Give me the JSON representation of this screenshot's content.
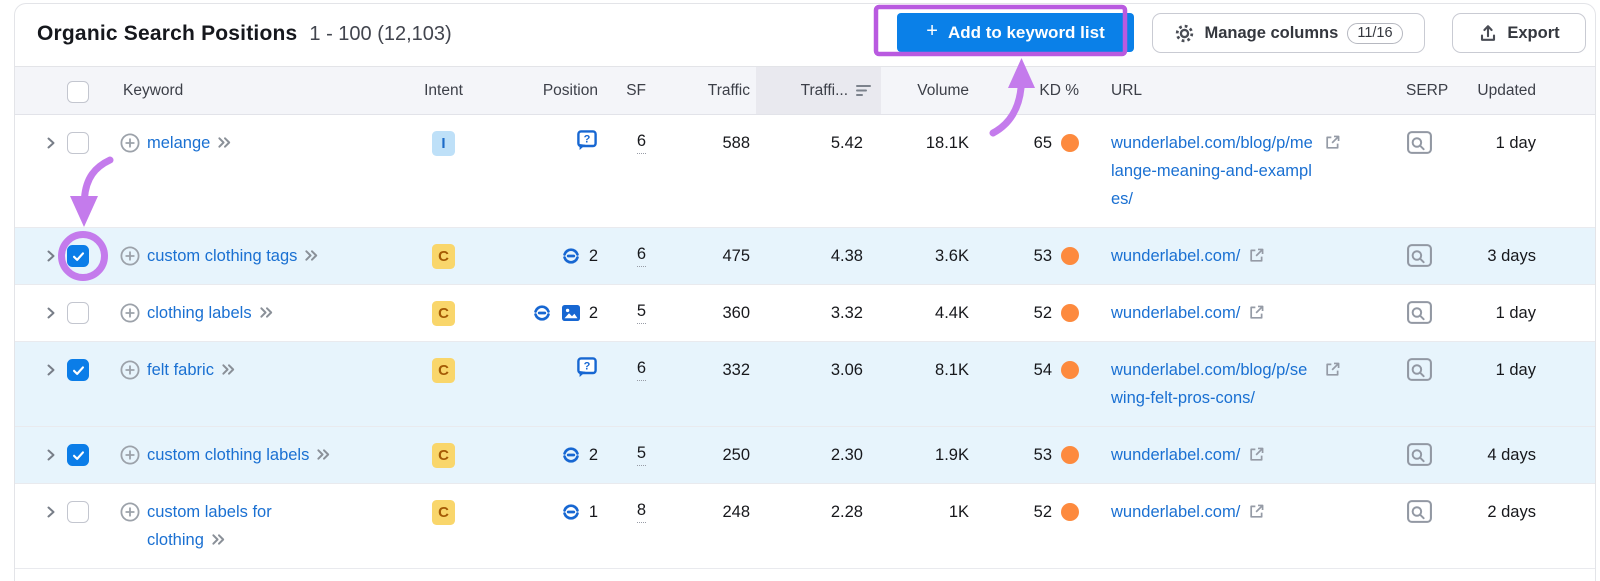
{
  "card": {
    "title": "Organic Search Positions",
    "range": "1 - 100 (12,103)",
    "toolbar": {
      "add_plus": "+",
      "add_label": "Add to keyword list",
      "manage_label": "Manage columns",
      "manage_badge": "11/16",
      "export_label": "Export"
    }
  },
  "table": {
    "headers": {
      "keyword": "Keyword",
      "intent": "Intent",
      "position": "Position",
      "sf": "SF",
      "traffic": "Traffic",
      "traffic_pct": "Traffi...",
      "volume": "Volume",
      "kd": "KD %",
      "url": "URL",
      "serp": "SERP",
      "updated": "Updated"
    },
    "rows": [
      {
        "checked": false,
        "selected": false,
        "keyword": "melange",
        "intent": "I",
        "pos_icons": [
          "question"
        ],
        "position": "",
        "sf": "6",
        "traffic": "588",
        "traffic_pct": "5.42",
        "volume": "18.1K",
        "kd": "65",
        "url": "wunderlabel.com/blog/p/melange-meaning-and-examples/",
        "updated": "1 day"
      },
      {
        "checked": true,
        "selected": true,
        "keyword": "custom clothing tags",
        "intent": "C",
        "pos_icons": [
          "link"
        ],
        "position": "2",
        "sf": "6",
        "traffic": "475",
        "traffic_pct": "4.38",
        "volume": "3.6K",
        "kd": "53",
        "url": "wunderlabel.com/",
        "updated": "3 days"
      },
      {
        "checked": false,
        "selected": false,
        "keyword": "clothing labels",
        "intent": "C",
        "pos_icons": [
          "link",
          "image"
        ],
        "position": "2",
        "sf": "5",
        "traffic": "360",
        "traffic_pct": "3.32",
        "volume": "4.4K",
        "kd": "52",
        "url": "wunderlabel.com/",
        "updated": "1 day"
      },
      {
        "checked": true,
        "selected": true,
        "keyword": "felt fabric",
        "intent": "C",
        "pos_icons": [
          "question"
        ],
        "position": "",
        "sf": "6",
        "traffic": "332",
        "traffic_pct": "3.06",
        "volume": "8.1K",
        "kd": "54",
        "url": "wunderlabel.com/blog/p/sewing-felt-pros-cons/",
        "updated": "1 day"
      },
      {
        "checked": true,
        "selected": true,
        "keyword": "custom clothing labels",
        "intent": "C",
        "pos_icons": [
          "link"
        ],
        "position": "2",
        "sf": "5",
        "traffic": "250",
        "traffic_pct": "2.30",
        "volume": "1.9K",
        "kd": "53",
        "url": "wunderlabel.com/",
        "updated": "4 days"
      },
      {
        "checked": false,
        "selected": false,
        "keyword": "custom labels for clothing",
        "intent": "C",
        "pos_icons": [
          "link"
        ],
        "position": "1",
        "sf": "8",
        "traffic": "248",
        "traffic_pct": "2.28",
        "volume": "1K",
        "kd": "52",
        "url": "wunderlabel.com/",
        "updated": "2 days"
      }
    ]
  },
  "colors": {
    "accent_blue": "#0a80e8",
    "link_blue": "#1a70d2",
    "kd_orange": "#fd8a3e",
    "annotation_box": "#b95ae0",
    "annotation_arrow": "#c47bec",
    "intent_info_bg": "#bee0f8",
    "intent_commercial_bg": "#f9d66b",
    "selected_row_bg": "#e7f4fc"
  }
}
